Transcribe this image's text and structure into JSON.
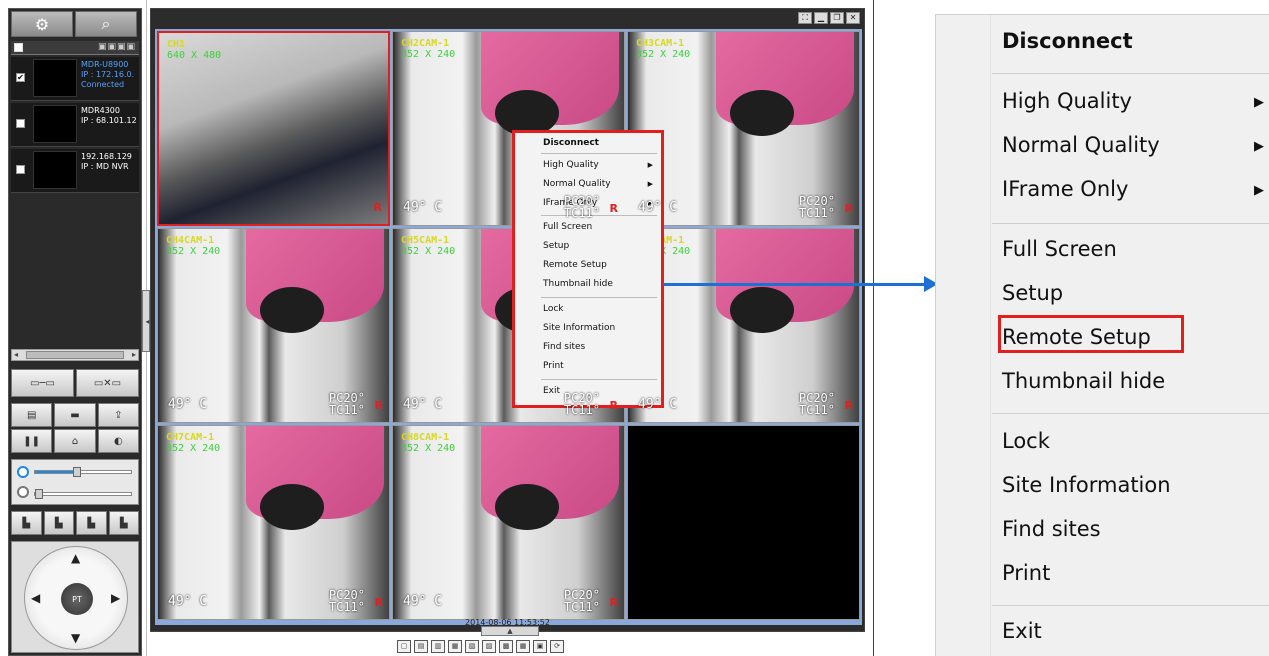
{
  "left_panel": {
    "sites": [
      {
        "checked": true,
        "name": "MDR-U8900",
        "ip": "IP : 172.16.0.",
        "status": "Connected"
      },
      {
        "checked": false,
        "name": "MDR4300",
        "ip": "IP : 68.101.12",
        "status": ""
      },
      {
        "checked": false,
        "name": "192.168.129",
        "ip": "IP : MD NVR",
        "status": ""
      }
    ],
    "ptz_center_label": "PT",
    "accent_color": "#1e88e5"
  },
  "viewer": {
    "tiles": [
      {
        "channel": "CH1",
        "resolution": "640 X 480",
        "type": "room",
        "temp": "",
        "brand_line1": "",
        "brand_line2": "",
        "rec": "R"
      },
      {
        "channel": "CH2CAM-1",
        "resolution": "352 X 240",
        "type": "cam",
        "temp": "49° C",
        "brand_line1": "PC20°",
        "brand_line2": "TC11°",
        "rec": "R"
      },
      {
        "channel": "CH3CAM-1",
        "resolution": "352 X 240",
        "type": "cam",
        "temp": "49° C",
        "brand_line1": "PC20°",
        "brand_line2": "TC11°",
        "rec": "R"
      },
      {
        "channel": "CH4CAM-1",
        "resolution": "352 X 240",
        "type": "cam",
        "temp": "49° C",
        "brand_line1": "PC20°",
        "brand_line2": "TC11°",
        "rec": "R"
      },
      {
        "channel": "CH5CAM-1",
        "resolution": "352 X 240",
        "type": "cam",
        "temp": "49° C",
        "brand_line1": "PC20°",
        "brand_line2": "TC11°",
        "rec": "R"
      },
      {
        "channel": "CH6CAM-1",
        "resolution": "352 X 240",
        "type": "cam",
        "temp": "49° C",
        "brand_line1": "PC20°",
        "brand_line2": "TC11°",
        "rec": "R"
      },
      {
        "channel": "CH7CAM-1",
        "resolution": "352 X 240",
        "type": "cam",
        "temp": "49° C",
        "brand_line1": "PC20°",
        "brand_line2": "TC11°",
        "rec": "R"
      },
      {
        "channel": "CH8CAM-1",
        "resolution": "352 X 240",
        "type": "cam",
        "temp": "49° C",
        "brand_line1": "PC20°",
        "brand_line2": "TC11°",
        "rec": "R"
      }
    ],
    "timestamp": "2014-08-06 11:53:52"
  },
  "context_menu": {
    "disconnect": "Disconnect",
    "high_quality": "High Quality",
    "normal_quality": "Normal Quality",
    "iframe_only": "IFrame Only",
    "full_screen": "Full Screen",
    "setup": "Setup",
    "remote_setup": "Remote Setup",
    "thumbnail_hide": "Thumbnail hide",
    "lock": "Lock",
    "site_information": "Site Information",
    "find_sites": "Find sites",
    "print": "Print",
    "exit": "Exit",
    "submenu_arrow": "▶",
    "highlight_color": "#e21f1f",
    "arrow_color": "#1e6fd6"
  }
}
